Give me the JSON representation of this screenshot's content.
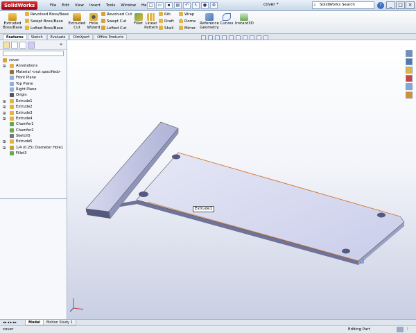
{
  "app": {
    "logo_text": "SolidWorks",
    "doc_title": "cover *",
    "search_placeholder": "SolidWorks Search",
    "help_label": "?"
  },
  "menu": [
    "File",
    "Edit",
    "View",
    "Insert",
    "Tools",
    "Window",
    "Help"
  ],
  "window_buttons": [
    "_",
    "□",
    "×"
  ],
  "ribbon": {
    "extruded_boss": "Extruded\nBoss/Base",
    "revolved_boss": "Revolved Boss/Base",
    "swept_boss": "Swept Boss/Base",
    "lofted_boss": "Lofted Boss/Base",
    "extruded_cut": "Extruded\nCut",
    "hole_wizard": "Hole\nWizard",
    "revolved_cut": "Revolved Cut",
    "swept_cut": "Swept Cut",
    "lofted_cut": "Lofted Cut",
    "fillet": "Fillet",
    "linear_pattern": "Linear\nPattern",
    "rib": "Rib",
    "draft": "Draft",
    "shell": "Shell",
    "wrap": "Wrap",
    "dome": "Dome",
    "mirror": "Mirror",
    "reference_geometry": "Reference\nGeometry",
    "curves": "Curves",
    "instant3d": "Instant3D"
  },
  "command_tabs": [
    "Features",
    "Sketch",
    "Evaluate",
    "DimXpert",
    "Office Products"
  ],
  "tree": [
    {
      "label": "cover",
      "expander": false,
      "indent": 0,
      "color": "#d9a431"
    },
    {
      "label": "Annotations",
      "expander": true,
      "indent": 1,
      "color": "#e2b542"
    },
    {
      "label": "Material <not specified>",
      "expander": false,
      "indent": 1,
      "color": "#9b6d2e"
    },
    {
      "label": "Front Plane",
      "expander": false,
      "indent": 1,
      "color": "#8fb0d8"
    },
    {
      "label": "Top Plane",
      "expander": false,
      "indent": 1,
      "color": "#8fb0d8"
    },
    {
      "label": "Right Plane",
      "expander": false,
      "indent": 1,
      "color": "#8fb0d8"
    },
    {
      "label": "Origin",
      "expander": false,
      "indent": 1,
      "color": "#555555"
    },
    {
      "label": "Extrude1",
      "expander": true,
      "indent": 1,
      "color": "#e2b542"
    },
    {
      "label": "Extrude2",
      "expander": true,
      "indent": 1,
      "color": "#e2b542"
    },
    {
      "label": "Extrude3",
      "expander": true,
      "indent": 1,
      "color": "#e2b542"
    },
    {
      "label": "Extrude4",
      "expander": true,
      "indent": 1,
      "color": "#e2b542"
    },
    {
      "label": "Chamfer1",
      "expander": false,
      "indent": 1,
      "color": "#6aa84f"
    },
    {
      "label": "Chamfer2",
      "expander": false,
      "indent": 1,
      "color": "#6aa84f"
    },
    {
      "label": "Sketch5",
      "expander": false,
      "indent": 1,
      "color": "#777777"
    },
    {
      "label": "Extrude5",
      "expander": true,
      "indent": 1,
      "color": "#e2b542"
    },
    {
      "label": "1/4 (0.25) Diameter Hole1",
      "expander": true,
      "indent": 1,
      "color": "#c9a13a"
    },
    {
      "label": "Fillet3",
      "expander": false,
      "indent": 1,
      "color": "#6aa84f"
    }
  ],
  "viewport": {
    "feature_tooltip": "Extrude1"
  },
  "bottom_tabs": [
    "Model",
    "Motion Study 1"
  ],
  "status": {
    "left": "cover",
    "right": "Editing Part"
  },
  "colors": {
    "accent_red": "#c8202a",
    "part_face": "#dcdff2",
    "selection_edge": "#e07a2e"
  }
}
